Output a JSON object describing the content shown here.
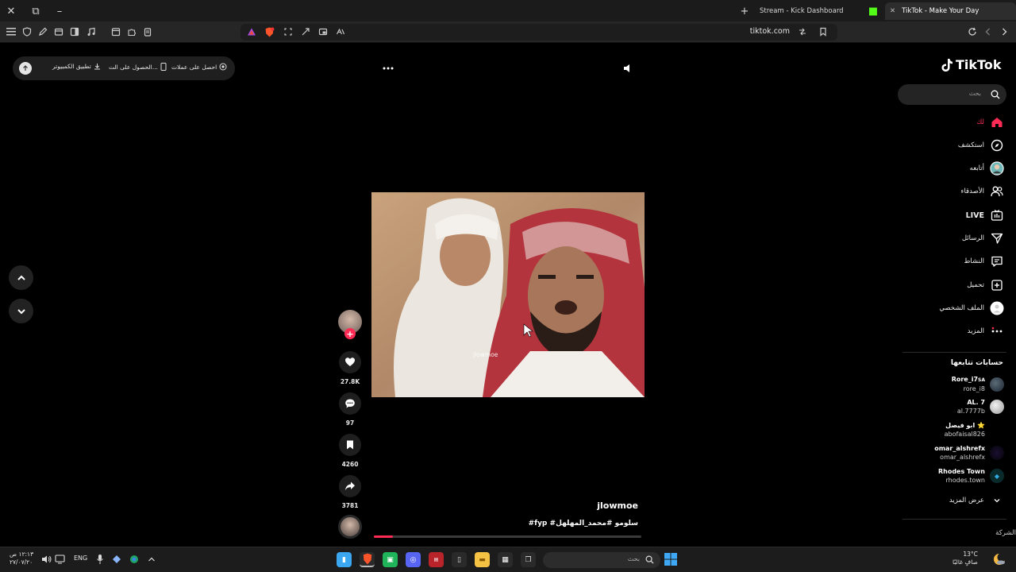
{
  "browser": {
    "tabs": [
      {
        "label": "Stream - Kick Dashboard",
        "active": false
      },
      {
        "label": "TikTok - Make Your Day",
        "active": true
      }
    ],
    "url": "tiktok.com"
  },
  "promo": {
    "desktop_app": "تطبيق الكمبيوتر",
    "get_app": "الحصول على الت...",
    "get_coins": "احصل على عملات"
  },
  "video": {
    "author": "jlowmoe",
    "watermark": "jlowmoe",
    "caption": "#fyp #سلومو #محمد_المهلهل",
    "progress": 0.07
  },
  "actions": {
    "likes": "27.8K",
    "comments": "97",
    "saves": "4260",
    "shares": "3781"
  },
  "sidebar": {
    "logo": "TikTok",
    "search_placeholder": "بحث",
    "nav": [
      {
        "label": "لك",
        "icon": "home-icon"
      },
      {
        "label": "استكشف",
        "icon": "compass-icon"
      },
      {
        "label": "أتابعه",
        "icon": "following-avatar-icon"
      },
      {
        "label": "الأصدقاء",
        "icon": "friends-icon"
      },
      {
        "label": "LIVE",
        "icon": "live-icon"
      },
      {
        "label": "الرسائل",
        "icon": "messages-icon"
      },
      {
        "label": "النشاط",
        "icon": "activity-icon"
      },
      {
        "label": "تحميل",
        "icon": "upload-icon"
      },
      {
        "label": "الملف الشخصي",
        "icon": "profile-icon"
      },
      {
        "label": "المزيد",
        "icon": "more-icon"
      }
    ],
    "following_title": "حسابات تتابعها",
    "accounts": [
      {
        "name": "Rore_i7",
        "sub_badge": "SA",
        "handle": "rore_i8"
      },
      {
        "name": "AL. 7",
        "handle": "al.7777b"
      },
      {
        "name": "ابو فيصل ⭐",
        "handle": "abofaisal826"
      },
      {
        "name": "omar_alshrefx",
        "handle": "omar_alshrefx"
      },
      {
        "name": "Rhodes Town",
        "handle": "rhodes.town"
      }
    ],
    "see_more": "عرض المزيد",
    "company": "الشركة"
  },
  "taskbar": {
    "search_placeholder": "بحث",
    "language": "ENG",
    "time": "١٢:١٣ ص",
    "date": "٢٧/٠٧/٢٠",
    "weather_temp": "13°C",
    "weather_desc": "صافٍ غالبًا"
  },
  "colors": {
    "accent": "#fe2c55",
    "sidebar_bg": "#000000",
    "taskbar_bg": "#1c1c1c"
  }
}
